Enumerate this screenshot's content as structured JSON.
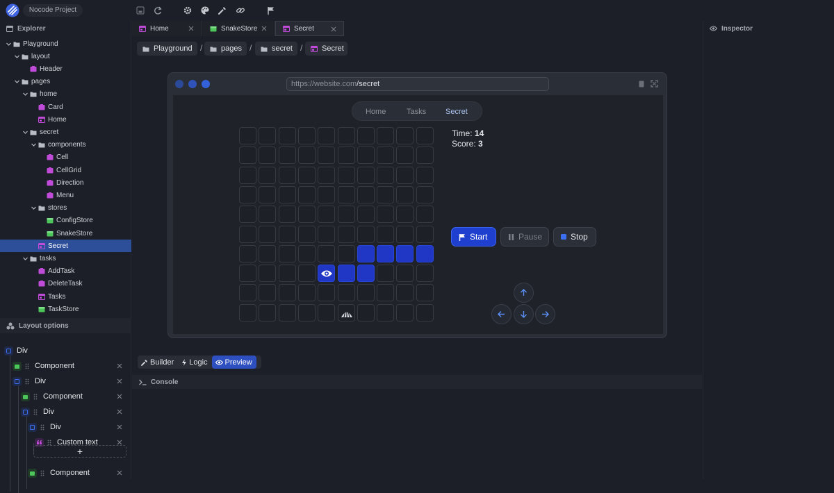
{
  "topbar": {
    "project_name": "Nocode Project",
    "icons": [
      "save-icon",
      "refresh-icon",
      "gear-icon",
      "palette-icon",
      "wrench-icon",
      "link-icon",
      "flag-icon"
    ]
  },
  "explorer": {
    "title": "Explorer",
    "tree": [
      {
        "label": "Playground",
        "type": "folder"
      },
      {
        "label": "layout",
        "type": "folder"
      },
      {
        "label": "Header",
        "type": "component"
      },
      {
        "label": "pages",
        "type": "folder"
      },
      {
        "label": "home",
        "type": "folder"
      },
      {
        "label": "Card",
        "type": "component"
      },
      {
        "label": "Home",
        "type": "page"
      },
      {
        "label": "secret",
        "type": "folder"
      },
      {
        "label": "components",
        "type": "folder"
      },
      {
        "label": "Cell",
        "type": "component"
      },
      {
        "label": "CellGrid",
        "type": "component"
      },
      {
        "label": "Direction",
        "type": "component"
      },
      {
        "label": "Menu",
        "type": "component"
      },
      {
        "label": "stores",
        "type": "folder"
      },
      {
        "label": "ConfigStore",
        "type": "store"
      },
      {
        "label": "SnakeStore",
        "type": "store"
      },
      {
        "label": "Secret",
        "type": "page",
        "selected": true
      },
      {
        "label": "tasks",
        "type": "folder"
      },
      {
        "label": "AddTask",
        "type": "component"
      },
      {
        "label": "DeleteTask",
        "type": "component"
      },
      {
        "label": "Tasks",
        "type": "page"
      },
      {
        "label": "TaskStore",
        "type": "store"
      }
    ]
  },
  "layout_options": {
    "title": "Layout options",
    "items": [
      {
        "label": "Div",
        "kind": "div"
      },
      {
        "label": "Component",
        "kind": "store"
      },
      {
        "label": "Div",
        "kind": "div"
      },
      {
        "label": "Component",
        "kind": "store"
      },
      {
        "label": "Div",
        "kind": "div"
      },
      {
        "label": "Div",
        "kind": "div"
      },
      {
        "label": "Custom text",
        "kind": "text"
      },
      {
        "label": "Component",
        "kind": "store"
      }
    ],
    "add_label": "+"
  },
  "tabs": [
    {
      "label": "Home",
      "kind": "page"
    },
    {
      "label": "SnakeStore",
      "kind": "store"
    },
    {
      "label": "Secret",
      "kind": "page",
      "active": true
    }
  ],
  "breadcrumb": [
    "Playground",
    "pages",
    "secret",
    "Secret"
  ],
  "breadcrumb_sep": "/",
  "browser": {
    "url_prefix": "https://website.com",
    "url_path": "/secret"
  },
  "app": {
    "nav": [
      "Home",
      "Tasks",
      "Secret"
    ],
    "nav_active": "Secret",
    "grid": {
      "rows": 10,
      "cols": 10,
      "snake_cells": [
        [
          6,
          6
        ],
        [
          6,
          7
        ],
        [
          6,
          8
        ],
        [
          6,
          9
        ],
        [
          7,
          5
        ],
        [
          7,
          6
        ]
      ],
      "head": [
        7,
        4
      ],
      "food": [
        9,
        5
      ]
    },
    "time_label": "Time:",
    "time_value": "14",
    "score_label": "Score:",
    "score_value": "3",
    "buttons": {
      "start": "Start",
      "pause": "Pause",
      "stop": "Stop"
    }
  },
  "modes": {
    "builder": "Builder",
    "logic": "Logic",
    "preview": "Preview",
    "active": "Preview"
  },
  "console": {
    "title": "Console"
  },
  "inspector": {
    "title": "Inspector"
  },
  "colors": {
    "accent": "#2d4fbf",
    "snake": "#1f37c4",
    "page_icon": "#c04bd8",
    "store_icon": "#4cc55a",
    "div_icon": "#3b6ff0"
  }
}
